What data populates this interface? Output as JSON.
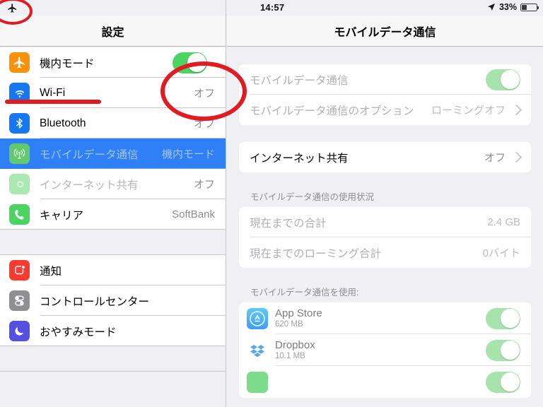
{
  "status_bar": {
    "airplane_icon": "airplane-icon",
    "time": "14:57",
    "location_icon": "location-arrow-icon",
    "battery_percent": "33%",
    "battery_level": 33
  },
  "sidebar": {
    "title": "設定",
    "groups": [
      {
        "items": [
          {
            "label": "機内モード",
            "icon": "airplane-icon",
            "icon_color": "#f99206",
            "control": "toggle",
            "toggle_on": true,
            "value": "",
            "selected": false,
            "dim": false
          },
          {
            "label": "Wi-Fi",
            "icon": "wifi-icon",
            "icon_color": "#1578f2",
            "control": "value",
            "value": "オフ",
            "selected": false,
            "dim": false
          },
          {
            "label": "Bluetooth",
            "icon": "bluetooth-icon",
            "icon_color": "#1578f2",
            "control": "value",
            "value": "オフ",
            "selected": false,
            "dim": false
          },
          {
            "label": "モバイルデータ通信",
            "icon": "cellular-tower-icon",
            "icon_color": "#4cd462",
            "control": "value",
            "value": "機内モード",
            "selected": true,
            "dim": false
          },
          {
            "label": "インターネット共有",
            "icon": "personal-hotspot-icon",
            "icon_color": "#a5e8ad",
            "control": "value",
            "value": "オフ",
            "selected": false,
            "dim": true
          },
          {
            "label": "キャリア",
            "icon": "phone-icon",
            "icon_color": "#4cd462",
            "control": "value",
            "value": "SoftBank",
            "selected": false,
            "dim": false
          }
        ]
      },
      {
        "items": [
          {
            "label": "通知",
            "icon": "notifications-icon",
            "icon_color": "#fc3b30",
            "control": "none",
            "value": "",
            "selected": false,
            "dim": false
          },
          {
            "label": "コントロールセンター",
            "icon": "control-center-icon",
            "icon_color": "#8e8e93",
            "control": "none",
            "value": "",
            "selected": false,
            "dim": false
          },
          {
            "label": "おやすみモード",
            "icon": "moon-icon",
            "icon_color": "#5550e0",
            "control": "none",
            "value": "",
            "selected": false,
            "dim": false
          }
        ]
      }
    ]
  },
  "detail": {
    "title": "モバイルデータ通信",
    "group1": {
      "rows": [
        {
          "label": "モバイルデータ通信",
          "value": "",
          "control": "toggle",
          "toggle_on": true,
          "toggle_faded": true,
          "chevron": false,
          "dim": true
        },
        {
          "label": "モバイルデータ通信のオプション",
          "value": "ローミングオフ",
          "control": "chevron",
          "chevron": true,
          "dim": true
        }
      ]
    },
    "group2": {
      "rows": [
        {
          "label": "インターネット共有",
          "value": "オフ",
          "control": "chevron",
          "chevron": true,
          "dim": false
        }
      ]
    },
    "usage_header": "モバイルデータ通信の使用状況",
    "group3": {
      "rows": [
        {
          "label": "現在までの合計",
          "value": "2.4 GB",
          "dim": true
        },
        {
          "label": "現在までのローミング合計",
          "value": "0バイト",
          "dim": true
        }
      ]
    },
    "apps_header": "モバイルデータ通信を使用:",
    "apps": [
      {
        "name": "App Store",
        "size": "620 MB",
        "icon": "app-store-icon",
        "icon_color": "#59c0f5",
        "toggle_on": true
      },
      {
        "name": "Dropbox",
        "size": "10.1 MB",
        "icon": "dropbox-icon",
        "icon_color": "#ffffff",
        "toggle_on": true
      },
      {
        "name": "",
        "size": "",
        "icon": "app-icon",
        "icon_color": "#7ddc8c",
        "toggle_on": true
      }
    ]
  },
  "annotations": {
    "accent_color": "#e01b22",
    "items": [
      {
        "type": "ellipse",
        "name": "annotation-circle-status-airplane"
      },
      {
        "type": "ellipse",
        "name": "annotation-circle-airplane-toggle"
      },
      {
        "type": "line",
        "name": "annotation-underline-airplane-row"
      }
    ]
  }
}
